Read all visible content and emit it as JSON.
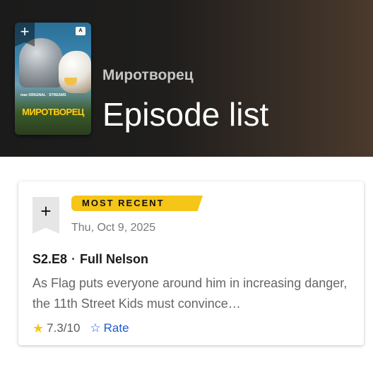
{
  "header": {
    "series_name": "Миротворец",
    "page_title": "Episode list",
    "poster": {
      "title_text": "МИРОТВОРЕЦ",
      "brand_text": "max ORIGINAL · STREAMS",
      "age_badge": "A"
    }
  },
  "episode": {
    "badge_label": "MOST RECENT",
    "air_date": "Thu, Oct 9, 2025",
    "code": "S2.E8",
    "separator": "·",
    "title": "Full Nelson",
    "description": "As Flag puts everyone around him in increasing danger, the 11th Street Kids must convince…",
    "rating": "7.3/10",
    "rate_label": "Rate"
  },
  "colors": {
    "accent_yellow": "#f5c518",
    "link_blue": "#1f5bd6"
  }
}
